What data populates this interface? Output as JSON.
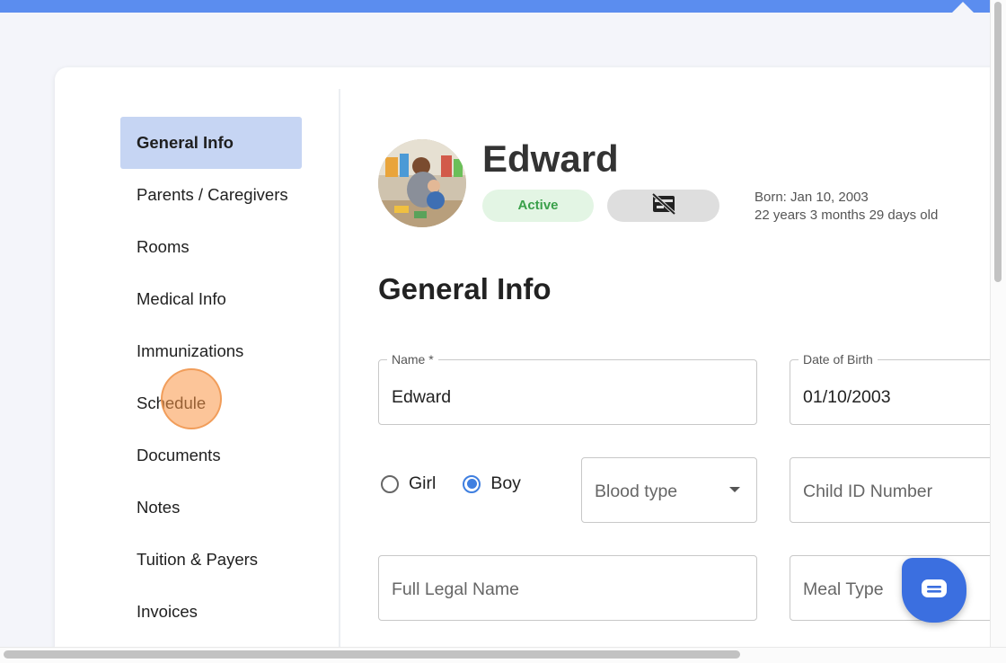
{
  "sidebar": {
    "items": [
      {
        "label": "General Info",
        "active": true
      },
      {
        "label": "Parents / Caregivers"
      },
      {
        "label": "Rooms"
      },
      {
        "label": "Medical Info"
      },
      {
        "label": "Immunizations"
      },
      {
        "label": "Schedule"
      },
      {
        "label": "Documents"
      },
      {
        "label": "Notes"
      },
      {
        "label": "Tuition & Payers"
      },
      {
        "label": "Invoices"
      }
    ]
  },
  "profile": {
    "name": "Edward",
    "status": "Active",
    "status_color": "#3aa04a",
    "card_icon": "no-card-icon",
    "born_line": "Born: Jan 10, 2003",
    "age_line": "22 years 3 months 29 days old"
  },
  "section": {
    "title": "General Info"
  },
  "form": {
    "name_label": "Name *",
    "name_value": "Edward",
    "dob_label": "Date of Birth",
    "dob_value": "01/10/2003",
    "gender_girl": "Girl",
    "gender_boy": "Boy",
    "gender_selected": "Boy",
    "blood_type_placeholder": "Blood type",
    "child_id_placeholder": "Child ID Number",
    "full_legal_name_placeholder": "Full Legal Name",
    "meal_type_placeholder": "Meal Type"
  },
  "colors": {
    "accent": "#3f7fe0",
    "topbar": "#5b8def",
    "active_nav": "#c6d5f3",
    "chat_button": "#3b6fe0"
  }
}
